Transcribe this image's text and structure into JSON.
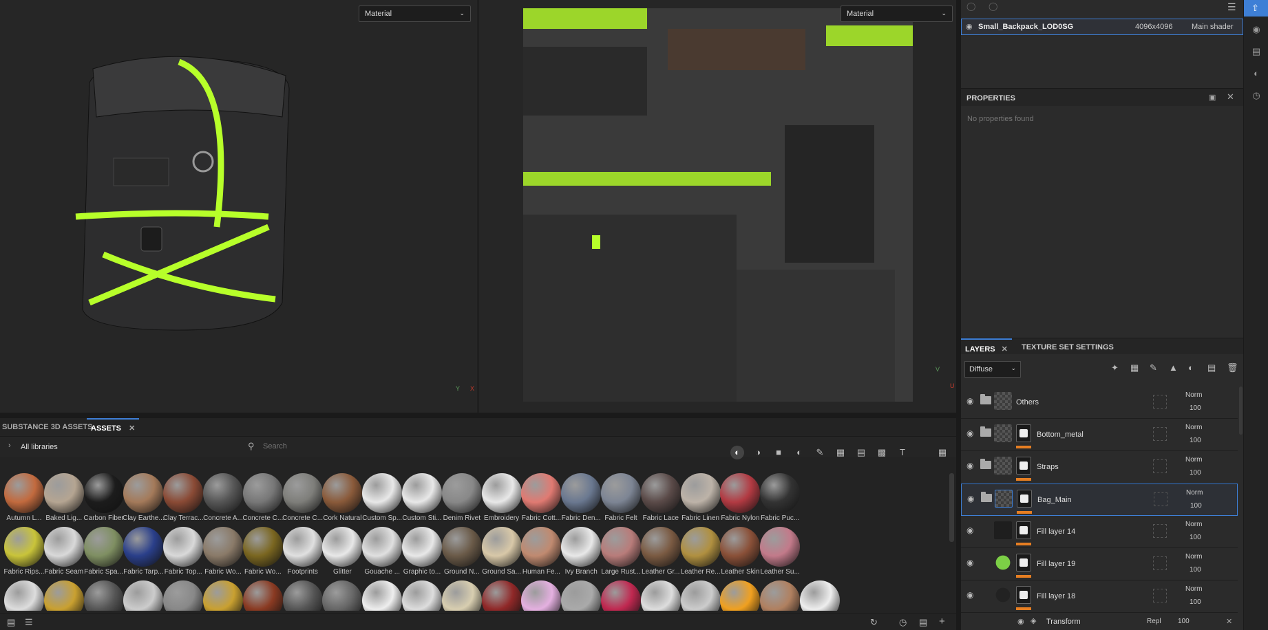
{
  "viewport3d": {
    "dropdown": "Material",
    "axis_y": "Y",
    "axis_x": "X"
  },
  "viewport2d": {
    "dropdown": "Material",
    "axis_v": "V",
    "axis_u": "U"
  },
  "texture_set": {
    "name": "Small_Backpack_LOD0SG",
    "resolution": "4096x4096",
    "shader": "Main shader"
  },
  "properties": {
    "title": "PROPERTIES",
    "empty": "No properties found"
  },
  "layers_panel": {
    "tab_layers": "LAYERS",
    "tab_texture_settings": "TEXTURE SET SETTINGS",
    "channel": "Diffuse"
  },
  "layers": [
    {
      "name": "Others",
      "blend": "Norm",
      "opacity": "100"
    },
    {
      "name": "Bottom_metal",
      "blend": "Norm",
      "opacity": "100"
    },
    {
      "name": "Straps",
      "blend": "Norm",
      "opacity": "100"
    },
    {
      "name": "Bag_Main",
      "blend": "Norm",
      "opacity": "100"
    },
    {
      "name": "Fill layer 14",
      "blend": "Norm",
      "opacity": "100"
    },
    {
      "name": "Fill layer 19",
      "blend": "Norm",
      "opacity": "100"
    },
    {
      "name": "Fill layer 18",
      "blend": "Norm",
      "opacity": "100"
    }
  ],
  "transform": {
    "name": "Transform",
    "blend": "Repl",
    "opacity": "100"
  },
  "assets_panel": {
    "tab1": "SUBSTANCE 3D ASSETS",
    "tab2": "ASSETS",
    "libraries": "All libraries",
    "search_placeholder": "Search"
  },
  "assets_row1": [
    "Autumn L...",
    "Baked Lig...",
    "Carbon Fiber",
    "Clay Earthe...",
    "Clay Terrac...",
    "Concrete A...",
    "Concrete C...",
    "Concrete C...",
    "Cork Natural",
    "Custom Sp...",
    "Custom Sti...",
    "Denim Rivet",
    "Embroidery",
    "Fabric Cott...",
    "Fabric Den...",
    "Fabric Felt",
    "Fabric Lace",
    "Fabric Linen",
    "Fabric Nylon",
    "Fabric Puc..."
  ],
  "assets_row2": [
    "Fabric Rips...",
    "Fabric Seam",
    "Fabric Spa...",
    "Fabric Tarp...",
    "Fabric Top...",
    "Fabric Wo...",
    "Fabric Wo...",
    "Footprints",
    "Glitter",
    "Gouache ...",
    "Graphic to...",
    "Ground N...",
    "Ground Sa...",
    "Human Fe...",
    "Ivy Branch",
    "Large Rust...",
    "Leather Gr...",
    "Leather Re...",
    "Leather Skin",
    "Leather Su..."
  ],
  "colors": {
    "accent": "#3e7fd6",
    "orange": "#e67e22",
    "neon": "#b7ff2a"
  }
}
